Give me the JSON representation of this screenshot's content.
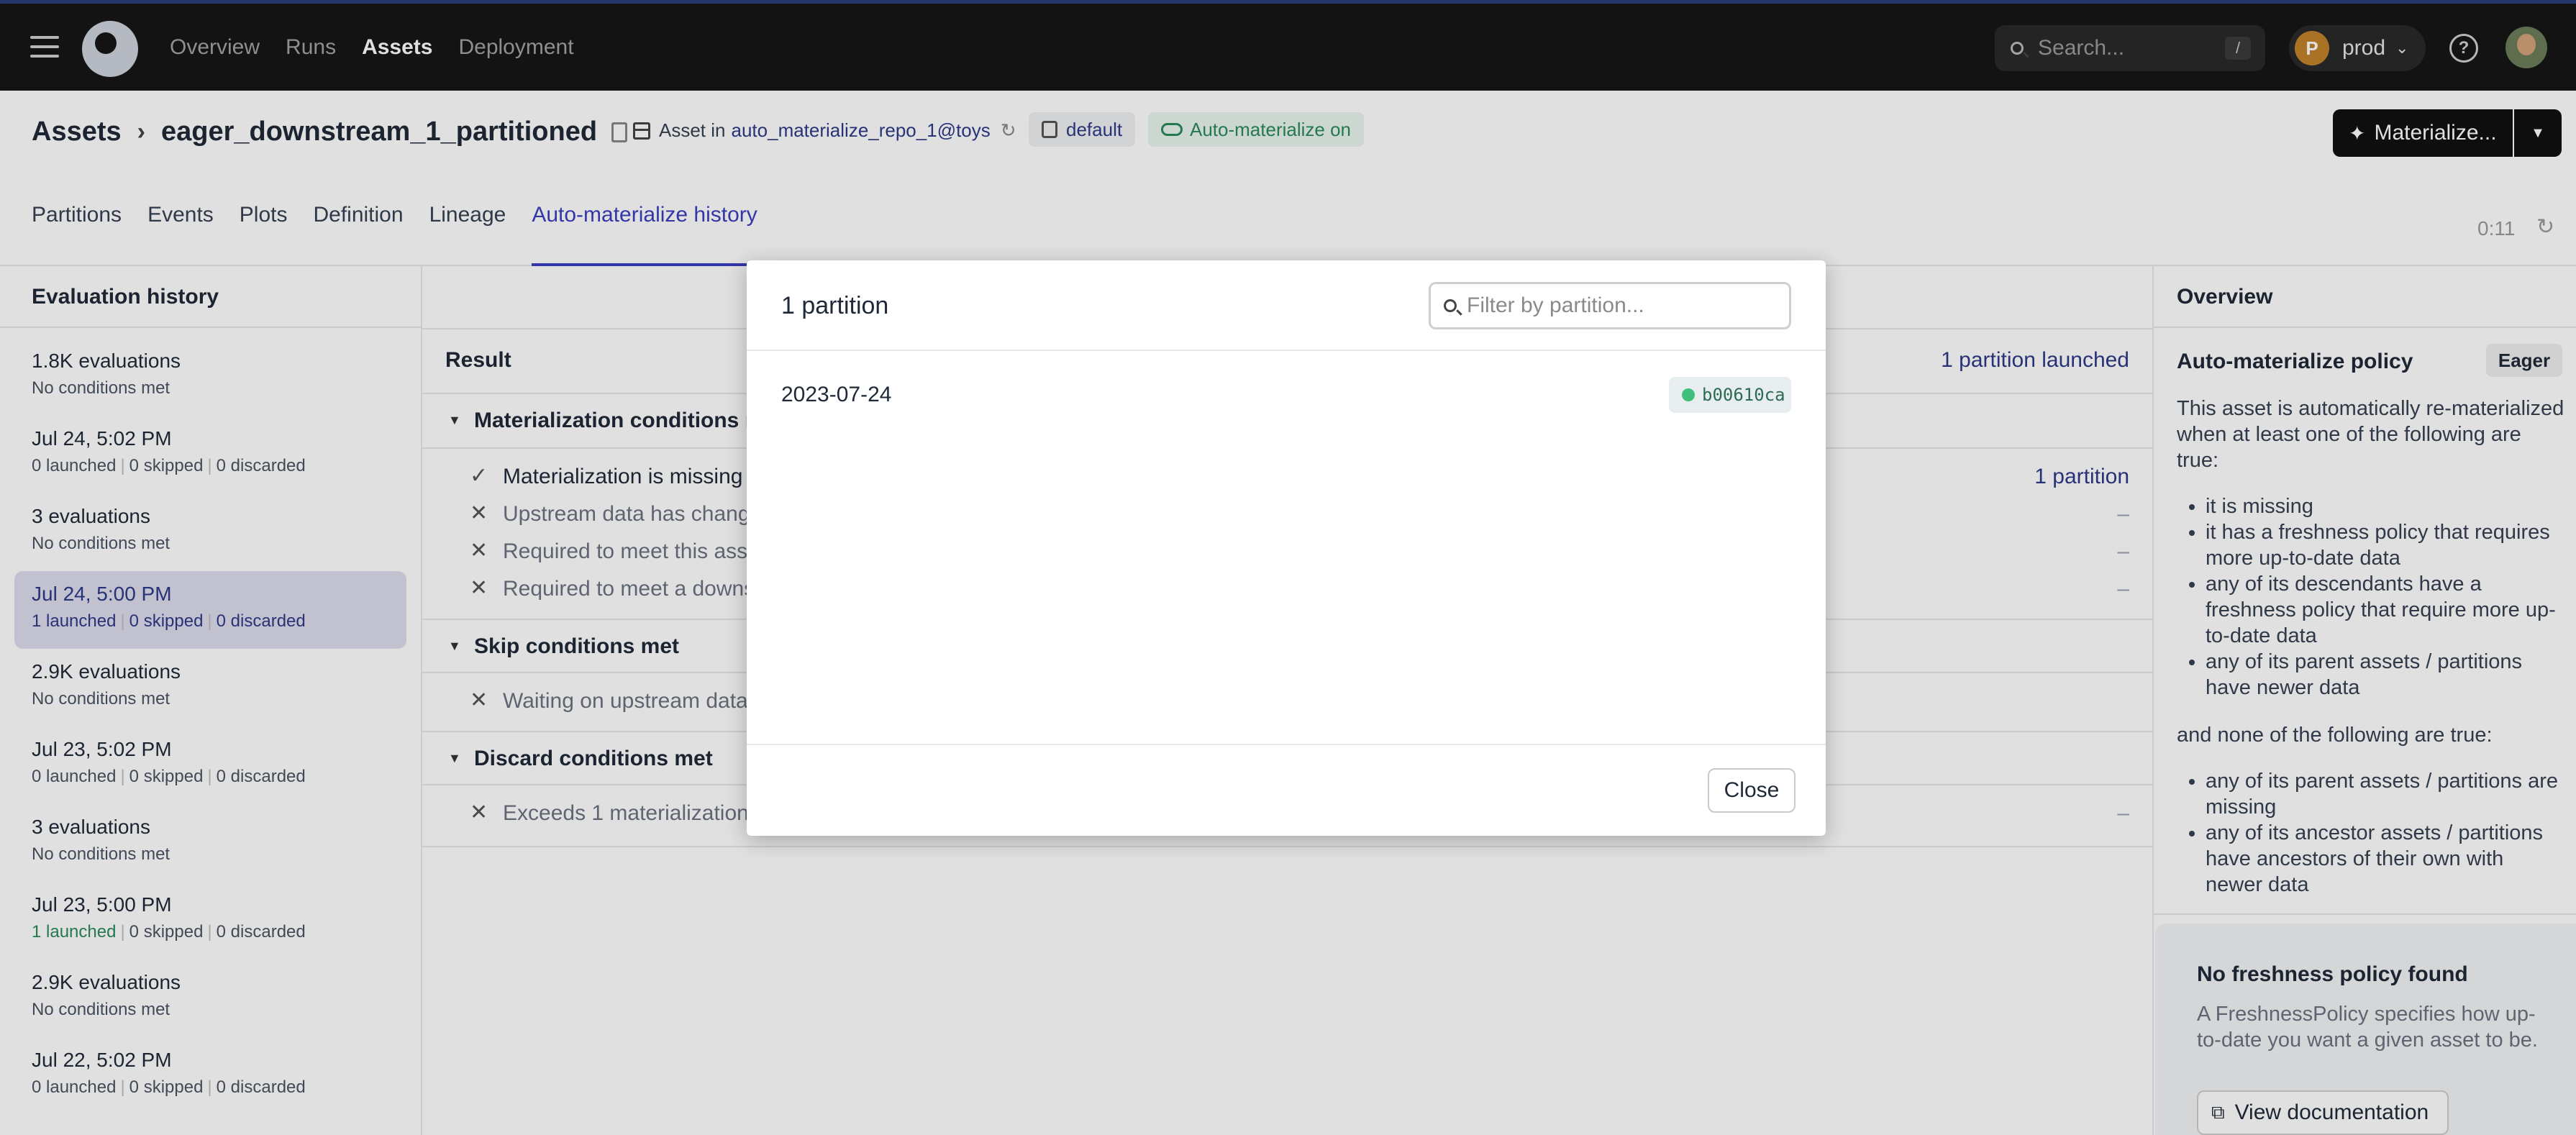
{
  "topnav": {
    "links": [
      "Overview",
      "Runs",
      "Assets",
      "Deployment"
    ],
    "active": "Assets",
    "search_placeholder": "Search...",
    "search_shortcut": "/",
    "deployment_initial": "P",
    "deployment_name": "prod"
  },
  "header": {
    "breadcrumb_root": "Assets",
    "asset_name": "eager_downstream_1_partitioned",
    "asset_in_label": "Asset in",
    "repo_link": "auto_materialize_repo_1@toys",
    "code_location_tag": "default",
    "auto_tag": "Auto-materialize on",
    "materialize_label": "Materialize...",
    "tabs": [
      "Partitions",
      "Events",
      "Plots",
      "Definition",
      "Lineage",
      "Auto-materialize history"
    ],
    "active_tab": "Auto-materialize history",
    "timer": "0:11"
  },
  "evaluation_history": {
    "title": "Evaluation history",
    "items": [
      {
        "title": "1.8K evaluations",
        "sub": "No conditions met"
      },
      {
        "title": "Jul 24, 5:02 PM",
        "launched": "0 launched",
        "skipped": "0 skipped",
        "discarded": "0 discarded"
      },
      {
        "title": "3 evaluations",
        "sub": "No conditions met"
      },
      {
        "title": "Jul 24, 5:00 PM",
        "launched": "1 launched",
        "skipped": "0 skipped",
        "discarded": "0 discarded"
      },
      {
        "title": "2.9K evaluations",
        "sub": "No conditions met"
      },
      {
        "title": "Jul 23, 5:02 PM",
        "launched": "0 launched",
        "skipped": "0 skipped",
        "discarded": "0 discarded"
      },
      {
        "title": "3 evaluations",
        "sub": "No conditions met"
      },
      {
        "title": "Jul 23, 5:00 PM",
        "launched": "1 launched",
        "skipped": "0 skipped",
        "discarded": "0 discarded"
      },
      {
        "title": "2.9K evaluations",
        "sub": "No conditions met"
      },
      {
        "title": "Jul 22, 5:02 PM",
        "launched": "0 launched",
        "skipped": "0 skipped",
        "discarded": "0 discarded"
      }
    ]
  },
  "result": {
    "title": "Result",
    "summary": "1 partition launched",
    "materialization_section": "Materialization conditions m",
    "materialization_rows": [
      {
        "text": "Materialization is missing",
        "value": "1 partition"
      },
      {
        "text": "Upstream data has chang",
        "value": "–"
      },
      {
        "text": "Required to meet this ass",
        "value": "–"
      },
      {
        "text": "Required to meet a downs",
        "value": "–"
      }
    ],
    "skip_section": "Skip conditions met",
    "skip_rows": [
      {
        "text": "Waiting on upstream data",
        "value": ""
      }
    ],
    "discard_section": "Discard conditions met",
    "discard_rows": [
      {
        "text": "Exceeds 1 materialization",
        "value": "–"
      }
    ]
  },
  "overview": {
    "title": "Overview",
    "policy_label": "Auto-materialize policy",
    "policy_badge": "Eager",
    "intro": "This asset is automatically re-materialized when at least one of the following are true:",
    "true_conditions": [
      "it is missing",
      "it has a freshness policy that requires more up-to-date data",
      "any of its descendants have a freshness policy that require more up-to-date data",
      "any of its parent assets / partitions have newer data"
    ],
    "none_intro": "and none of the following are true:",
    "false_conditions": [
      "any of its parent assets / partitions are missing",
      "any of its ancestor assets / partitions have ancestors of their own with newer data"
    ],
    "freshness_title": "No freshness policy found",
    "freshness_body": "A FreshnessPolicy specifies how up-to-date you want a given asset to be.",
    "doc_button": "View documentation"
  },
  "dialog": {
    "title": "1 partition",
    "filter_placeholder": "Filter by partition...",
    "partition_key": "2023-07-24",
    "run_id": "b00610ca",
    "close_label": "Close"
  }
}
